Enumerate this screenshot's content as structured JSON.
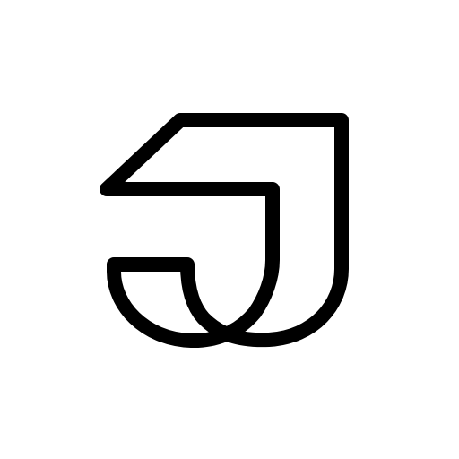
{
  "logo": {
    "icon": "monoline-j-logo-icon",
    "stroke_color": "#000000",
    "background_color": "#ffffff"
  }
}
